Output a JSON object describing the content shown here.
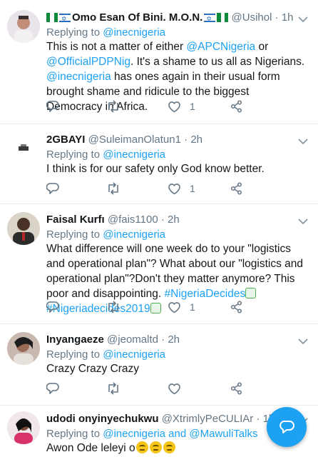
{
  "colors": {
    "accent": "#1da1f2",
    "muted": "#657786",
    "text": "#14171a",
    "divider": "#e6ecf0"
  },
  "tweets": [
    {
      "name": "Omo Esan Of Bini. M.O.N.",
      "handle": "@Usihol",
      "dot": "·",
      "time": "1h",
      "replying_prefix": "Replying to ",
      "replying_to": "@inecnigeria",
      "text": {
        "p1": "This is not a matter of either ",
        "m1": "@APCNigeria",
        "p2": " or ",
        "m2": "@OfficialPDPNig",
        "p3": ". It's a shame to us all as Nigerians. ",
        "m3": "@inecnigeria",
        "p4": " has ones again in their usual form brought shame and ridicule to the biggest Democracy in Africa."
      },
      "likes": "1"
    },
    {
      "name": "2GBAYI",
      "handle": "@SuleimanOlatun1",
      "dot": "·",
      "time": "2h",
      "replying_prefix": "Replying to ",
      "replying_to": "@inecnigeria",
      "text": "I think is for our safety only God know better.",
      "likes": "1"
    },
    {
      "name": "Faisal Kurfı",
      "handle": "@fais1100",
      "dot": "·",
      "time": "2h",
      "replying_prefix": "Replying to ",
      "replying_to": "@inecnigeria",
      "text": "What difference will one week do to your \"logistics and operational plan\"? What about our \"logistics and operational plan\"?Don't they matter anymore? This poor and disappointing. ",
      "hashtag1": "#NigeriaDecides",
      "hashtag2": "#Nigeriadecides2019",
      "likes": "1"
    },
    {
      "name": "Inyangaeze",
      "handle": "@jeomaltd",
      "dot": "·",
      "time": "2h",
      "replying_prefix": "Replying to ",
      "replying_to": "@inecnigeria",
      "text": "Crazy Crazy Crazy",
      "likes": ""
    },
    {
      "name": "udodi onyinyechukwu",
      "handle": "@XtrimlyPeCULIAr",
      "dot": "·",
      "time": "1h",
      "replying_prefix": "Replying to ",
      "replying_to": "@inecnigeria",
      "replying_and": " and ",
      "replying_to2": "@MawuliTalks",
      "text": "Awon Ode leleyi o"
    }
  ],
  "icons": [
    "reply-icon",
    "retweet-icon",
    "like-icon",
    "share-icon",
    "chevron-down-icon",
    "compose-reply-icon"
  ]
}
